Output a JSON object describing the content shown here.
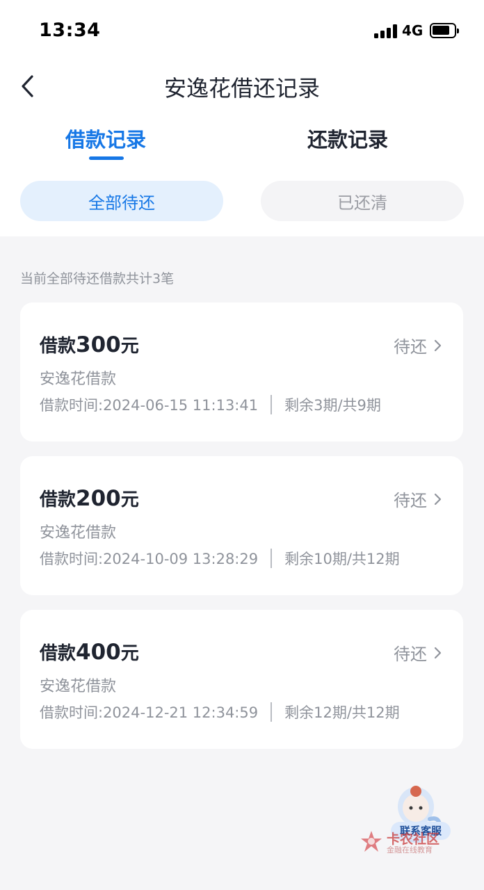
{
  "status_bar": {
    "time": "13:34",
    "network": "4G"
  },
  "header": {
    "title": "安逸花借还记录"
  },
  "tabs": [
    {
      "label": "借款记录",
      "active": true
    },
    {
      "label": "还款记录",
      "active": false
    }
  ],
  "filters": [
    {
      "label": "全部待还",
      "selected": true
    },
    {
      "label": "已还清",
      "selected": false
    }
  ],
  "summary": "当前全部待还借款共计3笔",
  "loans": [
    {
      "title_prefix": "借款",
      "amount": "300",
      "unit": "元",
      "status": "待还",
      "product": "安逸花借款",
      "time": "借款时间:2024-06-15 11:13:41",
      "periods": "剩余3期/共9期"
    },
    {
      "title_prefix": "借款",
      "amount": "200",
      "unit": "元",
      "status": "待还",
      "product": "安逸花借款",
      "time": "借款时间:2024-10-09 13:28:29",
      "periods": "剩余10期/共12期"
    },
    {
      "title_prefix": "借款",
      "amount": "400",
      "unit": "元",
      "status": "待还",
      "product": "安逸花借款",
      "time": "借款时间:2024-12-21 12:34:59",
      "periods": "剩余12期/共12期"
    }
  ],
  "customer_service": {
    "label": "联系客服"
  },
  "watermark": {
    "name": "卡农社区",
    "sub": "金融在线教育"
  },
  "colors": {
    "accent": "#1677e6",
    "accent_bg": "#e4f0fd",
    "page_bg": "#f5f5f7",
    "muted": "#8f939b"
  },
  "icons": {
    "back": "chevron-left-icon",
    "card_arrow": "chevron-right-icon",
    "signal": "signal-icon",
    "battery": "battery-icon"
  }
}
